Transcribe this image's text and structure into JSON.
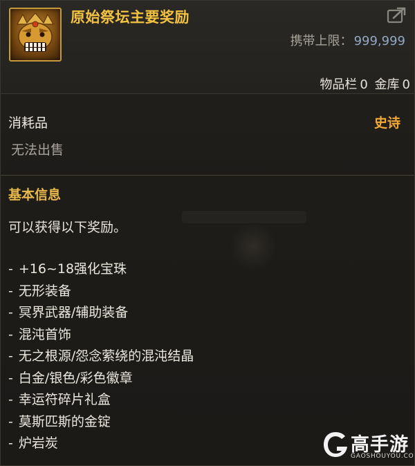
{
  "item": {
    "name": "原始祭坛主要奖励",
    "icon": "golden-demon-mask-icon",
    "carry_limit_label": "携带上限：",
    "carry_limit_value": "999,999",
    "inventory_label": "物品栏",
    "inventory_count": "0",
    "storage_label": "金库",
    "storage_count": "0"
  },
  "meta": {
    "category": "消耗品",
    "rarity": "史诗",
    "rarity_color": "#f0a935",
    "trade": "无法出售"
  },
  "info": {
    "section_title": "基本信息",
    "description": "可以获得以下奖励。",
    "rewards": [
      "+16~18强化宝珠",
      "无形装备",
      "冥界武器/辅助装备",
      "混沌首饰",
      "无之根源/怨念萦绕的混沌结晶",
      "白金/银色/彩色徽章",
      "幸运符碎片礼盒",
      "莫斯匹斯的金锭",
      "炉岩炭"
    ],
    "bullet": "-"
  },
  "watermark": {
    "brand": "高手游",
    "domain": "GAOSHOUYOU.COM"
  },
  "colors": {
    "title": "#f3c241",
    "section": "#e9b84a",
    "limit_value": "#93a8c5"
  }
}
